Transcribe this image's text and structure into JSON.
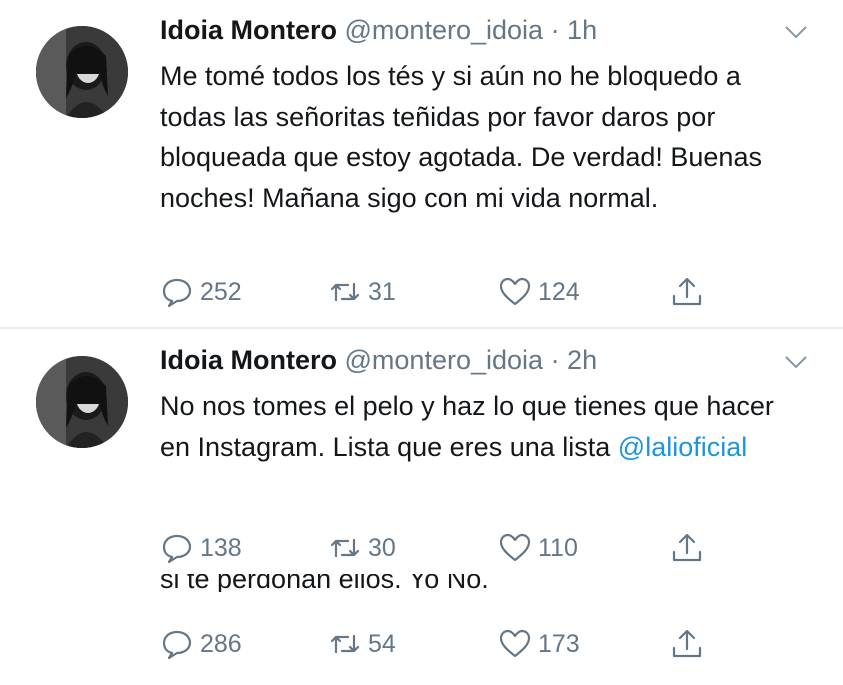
{
  "tweets": [
    {
      "name": "Idoia Montero",
      "handle": "@montero_idoia",
      "time": "· 1h",
      "text": "Me tomé todos los tés y si aún no he bloquedo a todas las señoritas teñidas por favor daros por bloqueada que estoy agotada. De verdad! Buenas noches! Mañana sigo con mi vida normal.",
      "replies": "252",
      "retweets": "31",
      "likes": "124"
    },
    {
      "name": "Idoia Montero",
      "handle": "@montero_idoia",
      "time": "· 2h",
      "text": "No nos tomes el pelo y haz lo que tienes que hacer en Instagram. Lista que eres una lista",
      "mention": "@lalioficial",
      "replies": "138",
      "retweets": "30",
      "likes": "110"
    }
  ],
  "partial_tweet": {
    "text": "si te perdonan ellos. Yo No.",
    "replies": "286",
    "retweets": "54",
    "likes": "173"
  },
  "colors": {
    "text": "#14171a",
    "secondary": "#657786",
    "link": "#1b95e0",
    "divider": "#e6ecf0"
  },
  "icons": [
    "reply-icon",
    "retweet-icon",
    "like-icon",
    "share-icon",
    "chevron-down-icon"
  ]
}
